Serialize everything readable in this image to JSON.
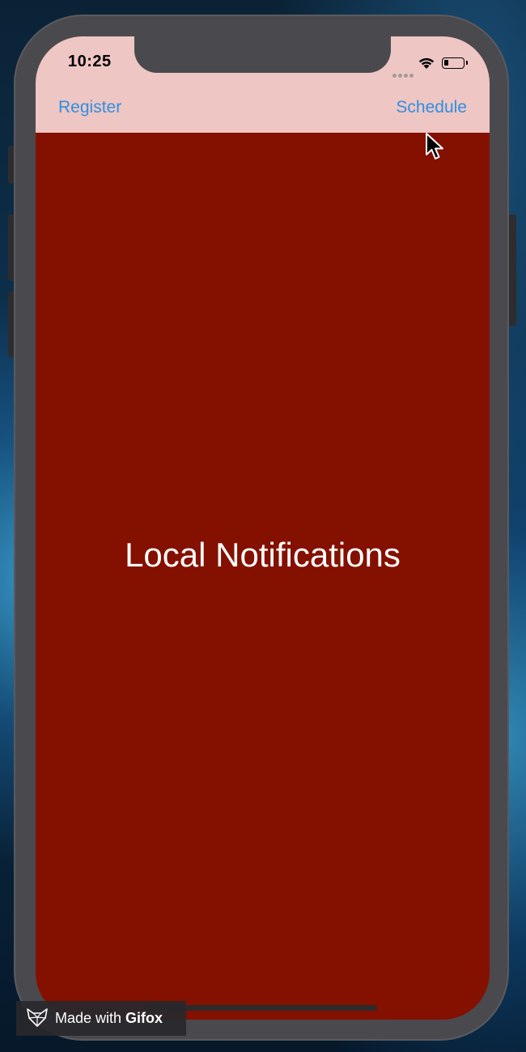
{
  "status_bar": {
    "time": "10:25",
    "signal_icon": "cellular-signal-icon",
    "wifi_icon": "wifi-icon",
    "battery_icon": "battery-icon"
  },
  "nav_bar": {
    "left_button": "Register",
    "right_button": "Schedule"
  },
  "main": {
    "title": "Local Notifications"
  },
  "watermark": {
    "prefix": "Made with ",
    "brand": "Gifox",
    "icon": "fox-logo-icon"
  },
  "colors": {
    "background": "#841000",
    "bars": "#eec6c4",
    "accent": "#2f8fe0",
    "title_text": "#ffffff"
  }
}
